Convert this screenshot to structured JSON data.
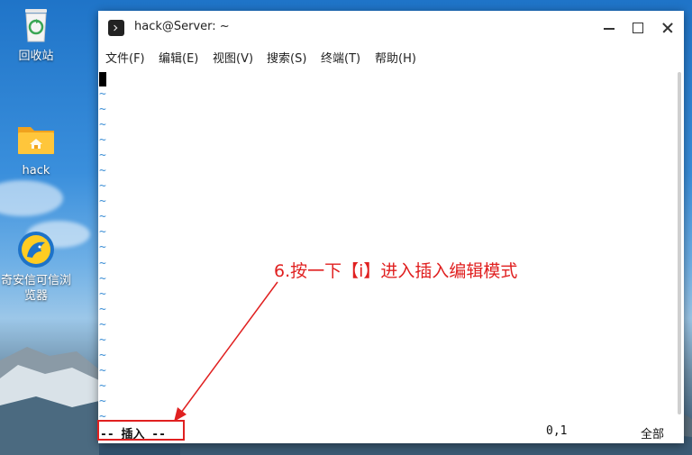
{
  "desktop": {
    "icons": [
      {
        "label": "回收站",
        "icon": "recycle-bin-icon"
      },
      {
        "label": "hack",
        "icon": "home-folder-icon"
      },
      {
        "label": "奇安信可信浏览器",
        "icon": "browser-icon"
      }
    ]
  },
  "window": {
    "title": "hack@Server: ~",
    "menu": [
      "文件(F)",
      "编辑(E)",
      "视图(V)",
      "搜索(S)",
      "终端(T)",
      "帮助(H)"
    ]
  },
  "editor": {
    "tilde_char": "~",
    "tilde_count": 22
  },
  "statusline": {
    "mode": "-- 插入 --",
    "cursor_pos": "0,1",
    "scroll_pos": "全部"
  },
  "annotation": {
    "text": "6.按一下【i】进入插入编辑模式",
    "color": "#e02020"
  },
  "colors": {
    "tilde": "#3d8fd6",
    "annotation": "#e02020"
  }
}
